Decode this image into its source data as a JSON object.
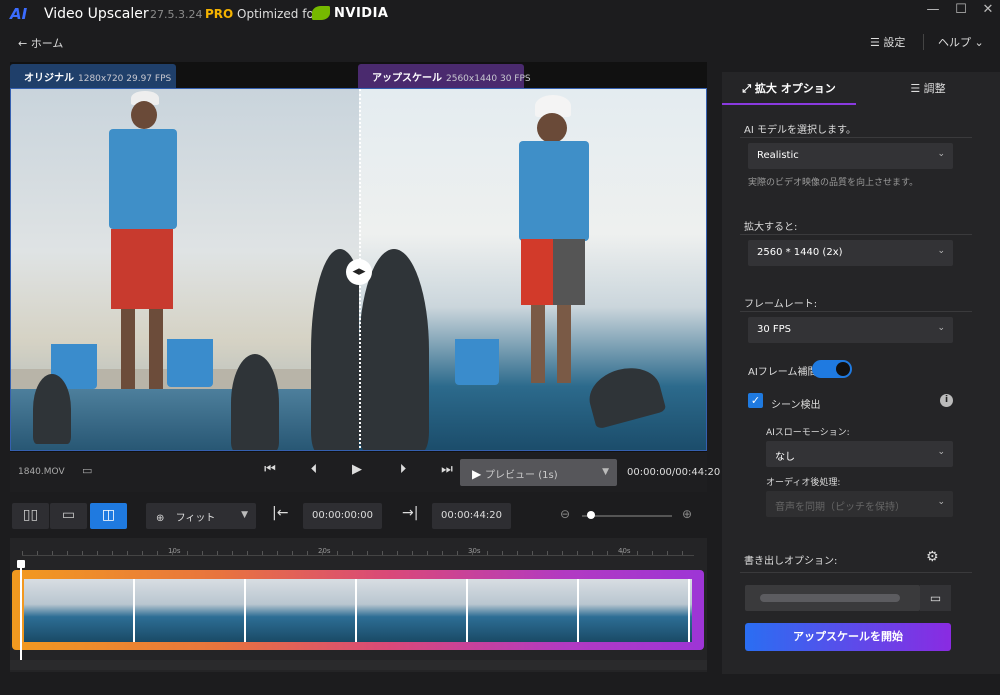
{
  "titlebar": {
    "logo": "AI",
    "app_name": "Video Upscaler",
    "version": "27.5.3.24",
    "pro": "PRO",
    "optimized": "Optimized for",
    "nvidia": "NVIDIA",
    "min": "—",
    "max": "☐",
    "close": "✕"
  },
  "nav": {
    "home": "← ホーム",
    "settings": "設定",
    "help": "ヘルプ"
  },
  "preview": {
    "original_label": "オリジナル",
    "original_info": "1280x720 29.97 FPS",
    "upscale_label": "アップスケール",
    "upscale_info": "2560x1440 30 FPS"
  },
  "controls": {
    "filename": "1840.MOV",
    "preview_label": "プレビュー (1s)",
    "timecode": "00:00:00/00:44:20"
  },
  "toolbar": {
    "zoom_label": "フィット",
    "start_time": "00:00:00:00",
    "end_time": "00:00:44:20",
    "zoom_level": 0.05
  },
  "timeline": {
    "ticks": [
      "10s",
      "20s",
      "30s",
      "40s"
    ]
  },
  "panel": {
    "tab_expand": "拡大 オプション",
    "tab_adjust": "調整",
    "ai_model_label": "AI モデルを選択します。",
    "ai_model_value": "Realistic",
    "ai_model_hint": "実際のビデオ映像の品質を向上させます。",
    "scale_label": "拡大すると:",
    "scale_value": "2560 * 1440 (2x)",
    "framerate_label": "フレームレート:",
    "framerate_value": "30 FPS",
    "ai_frame_label": "AIフレーム補間",
    "ai_frame_on": true,
    "scene_label": "シーン検出",
    "scene_checked": true,
    "slowmo_label": "AIスローモーション:",
    "slowmo_value": "なし",
    "audio_label": "オーディオ後処理:",
    "audio_value": "音声を同期（ピッチを保持）",
    "export_label": "書き出しオプション:",
    "start_button": "アップスケールを開始"
  },
  "colors": {
    "accent_blue": "#1f7ae0",
    "accent_purple": "#8a3ae0",
    "pro_gold": "#f5b301",
    "nvidia_green": "#76b900"
  }
}
